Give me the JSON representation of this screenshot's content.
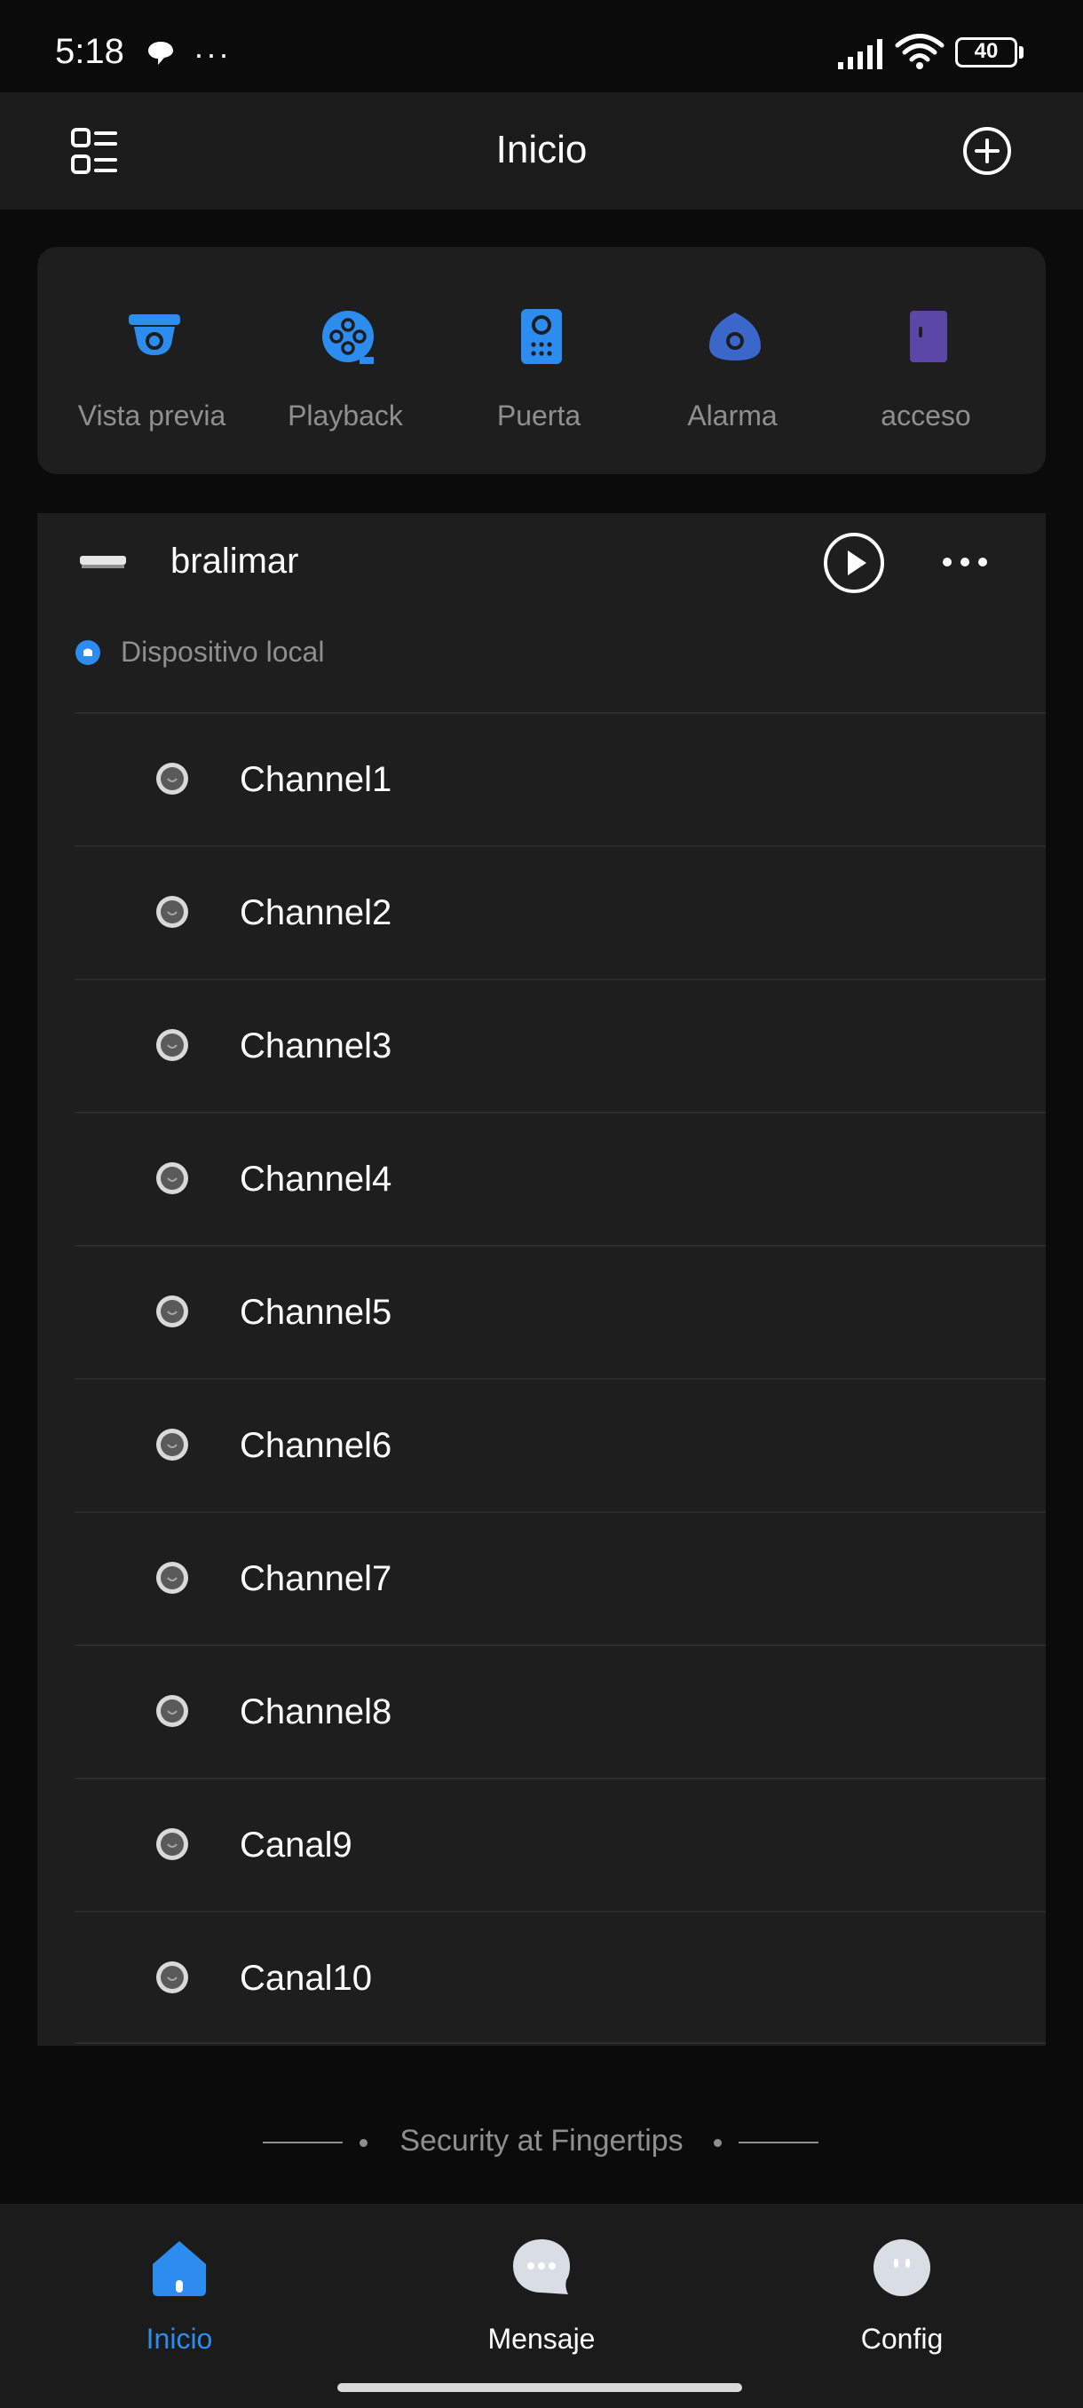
{
  "status_bar": {
    "time": "5:18",
    "dots": "···",
    "battery": "40"
  },
  "header": {
    "title": "Inicio"
  },
  "quick_actions": [
    {
      "label": "Vista previa",
      "icon": "camera-icon"
    },
    {
      "label": "Playback",
      "icon": "film-reel-icon"
    },
    {
      "label": "Puerta",
      "icon": "intercom-icon"
    },
    {
      "label": "Alarma",
      "icon": "alarm-icon"
    },
    {
      "label": "acceso",
      "icon": "door-icon"
    }
  ],
  "device": {
    "name": "bralimar",
    "group_label": "Dispositivo local",
    "channels": [
      "Channel1",
      "Channel2",
      "Channel3",
      "Channel4",
      "Channel5",
      "Channel6",
      "Channel7",
      "Channel8",
      "Canal9",
      "Canal10"
    ]
  },
  "tagline": "Security at Fingertips",
  "bottom_nav": [
    {
      "label": "Inicio",
      "icon": "home-icon",
      "active": true
    },
    {
      "label": "Mensaje",
      "icon": "message-icon",
      "active": false
    },
    {
      "label": "Config",
      "icon": "settings-icon",
      "active": false
    }
  ],
  "colors": {
    "accent": "#2d8cf0",
    "background": "#0b0b0b",
    "card": "#1e1e1e",
    "muted_text": "#8f8f8f"
  }
}
